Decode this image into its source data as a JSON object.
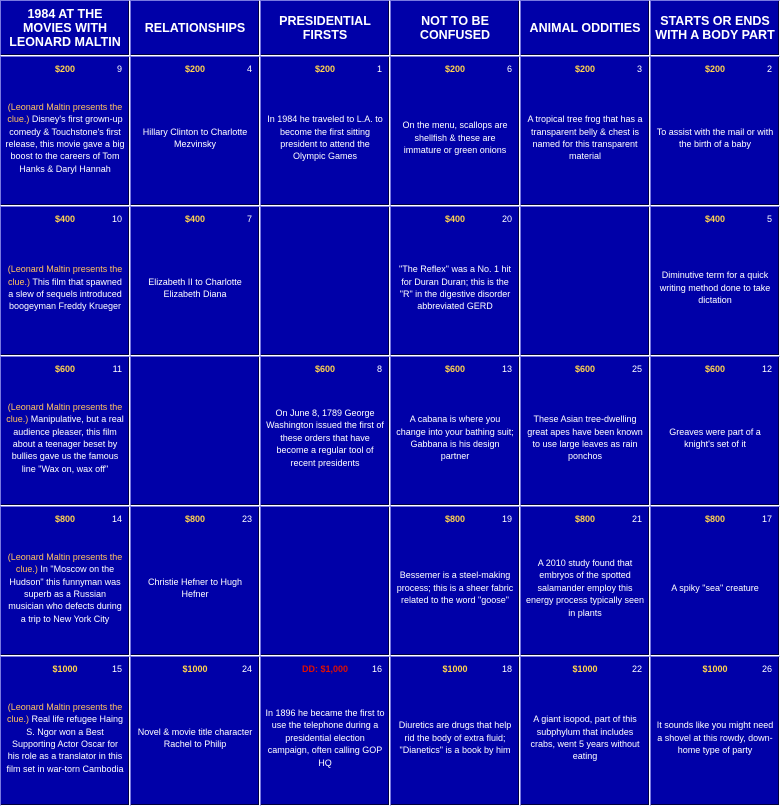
{
  "categories": [
    "1984 AT THE MOVIES WITH LEONARD MALTIN",
    "RELATIONSHIPS",
    "PRESIDENTIAL FIRSTS",
    "NOT TO BE CONFUSED",
    "ANIMAL ODDITIES",
    "STARTS OR ENDS WITH A BODY PART"
  ],
  "presenter_prefix": "(Leonard Maltin presents the clue.)",
  "rows": [
    [
      {
        "value": "$200",
        "order": "9",
        "text": " Disney's first grown-up comedy & Touchstone's first release, this movie gave a big boost to the careers of Tom Hanks & Daryl Hannah"
      },
      {
        "value": "$200",
        "order": "4",
        "text": "Hillary Clinton to Charlotte Mezvinsky"
      },
      {
        "value": "$200",
        "order": "1",
        "text": "In 1984 he traveled to L.A. to become the first sitting president to attend the Olympic Games"
      },
      {
        "value": "$200",
        "order": "6",
        "text": "On the menu, scallops are shellfish & these are immature or green onions"
      },
      {
        "value": "$200",
        "order": "3",
        "text": "A tropical tree frog that has a transparent belly & chest is named for this transparent material"
      },
      {
        "value": "$200",
        "order": "2",
        "text": "To assist with the mail or with the birth of a baby"
      }
    ],
    [
      {
        "value": "$400",
        "order": "10",
        "text": " This film that spawned a slew of sequels introduced boogeyman Freddy Krueger"
      },
      {
        "value": "$400",
        "order": "7",
        "text": "Elizabeth II to Charlotte Elizabeth Diana"
      },
      {
        "value": "",
        "order": "",
        "text": ""
      },
      {
        "value": "$400",
        "order": "20",
        "text": "\"The Reflex\" was a No. 1 hit for Duran Duran; this is the \"R\" in the digestive disorder abbreviated GERD"
      },
      {
        "value": "",
        "order": "",
        "text": ""
      },
      {
        "value": "$400",
        "order": "5",
        "text": "Diminutive term for a quick writing method done to take dictation"
      }
    ],
    [
      {
        "value": "$600",
        "order": "11",
        "text": " Manipulative, but a real audience pleaser, this film about a teenager beset by bullies gave us the famous line \"Wax on, wax off\""
      },
      {
        "value": "",
        "order": "",
        "text": ""
      },
      {
        "value": "$600",
        "order": "8",
        "text": "On June 8, 1789 George Washington issued the first of these orders that have become a regular tool of recent presidents"
      },
      {
        "value": "$600",
        "order": "13",
        "text": "A cabana is where you change into your bathing suit; Gabbana is his design partner"
      },
      {
        "value": "$600",
        "order": "25",
        "text": "These Asian tree-dwelling great apes have been known to use large leaves as rain ponchos"
      },
      {
        "value": "$600",
        "order": "12",
        "text": "Greaves were part of a knight's set of it"
      }
    ],
    [
      {
        "value": "$800",
        "order": "14",
        "text": " In \"Moscow on the Hudson\" this funnyman was superb as a Russian musician who defects during a trip to New York City"
      },
      {
        "value": "$800",
        "order": "23",
        "text": "Christie Hefner to Hugh Hefner"
      },
      {
        "value": "",
        "order": "",
        "text": ""
      },
      {
        "value": "$800",
        "order": "19",
        "text": "Bessemer is a steel-making process; this is a sheer fabric related to the word \"goose\""
      },
      {
        "value": "$800",
        "order": "21",
        "text": "A 2010 study found that embryos of the spotted salamander employ this energy process typically seen in plants"
      },
      {
        "value": "$800",
        "order": "17",
        "text": "A spiky \"sea\" creature"
      }
    ],
    [
      {
        "value": "$1000",
        "order": "15",
        "text": " Real life refugee Haing S. Ngor won a Best Supporting Actor Oscar for his role as a translator in this film set in war-torn Cambodia"
      },
      {
        "value": "$1000",
        "order": "24",
        "text": "Novel & movie title character Rachel to Philip"
      },
      {
        "value": "DD: $1,000",
        "order": "16",
        "text": "In 1896 he became the first to use the telephone during a presidential election campaign, often calling GOP HQ"
      },
      {
        "value": "$1000",
        "order": "18",
        "text": "Diuretics are drugs that help rid the body of extra fluid; \"Dianetics\" is a book by him"
      },
      {
        "value": "$1000",
        "order": "22",
        "text": "A giant isopod, part of this subphylum that includes crabs, went 5 years without eating"
      },
      {
        "value": "$1000",
        "order": "26",
        "text": "It sounds like you might need a shovel at this rowdy, down-home type of party"
      }
    ]
  ],
  "colors": {
    "board_blue": "#0000a8",
    "value_gold": "#ffd24d",
    "daily_double_red": "#e01000",
    "presenter_orange": "#ffc060"
  }
}
